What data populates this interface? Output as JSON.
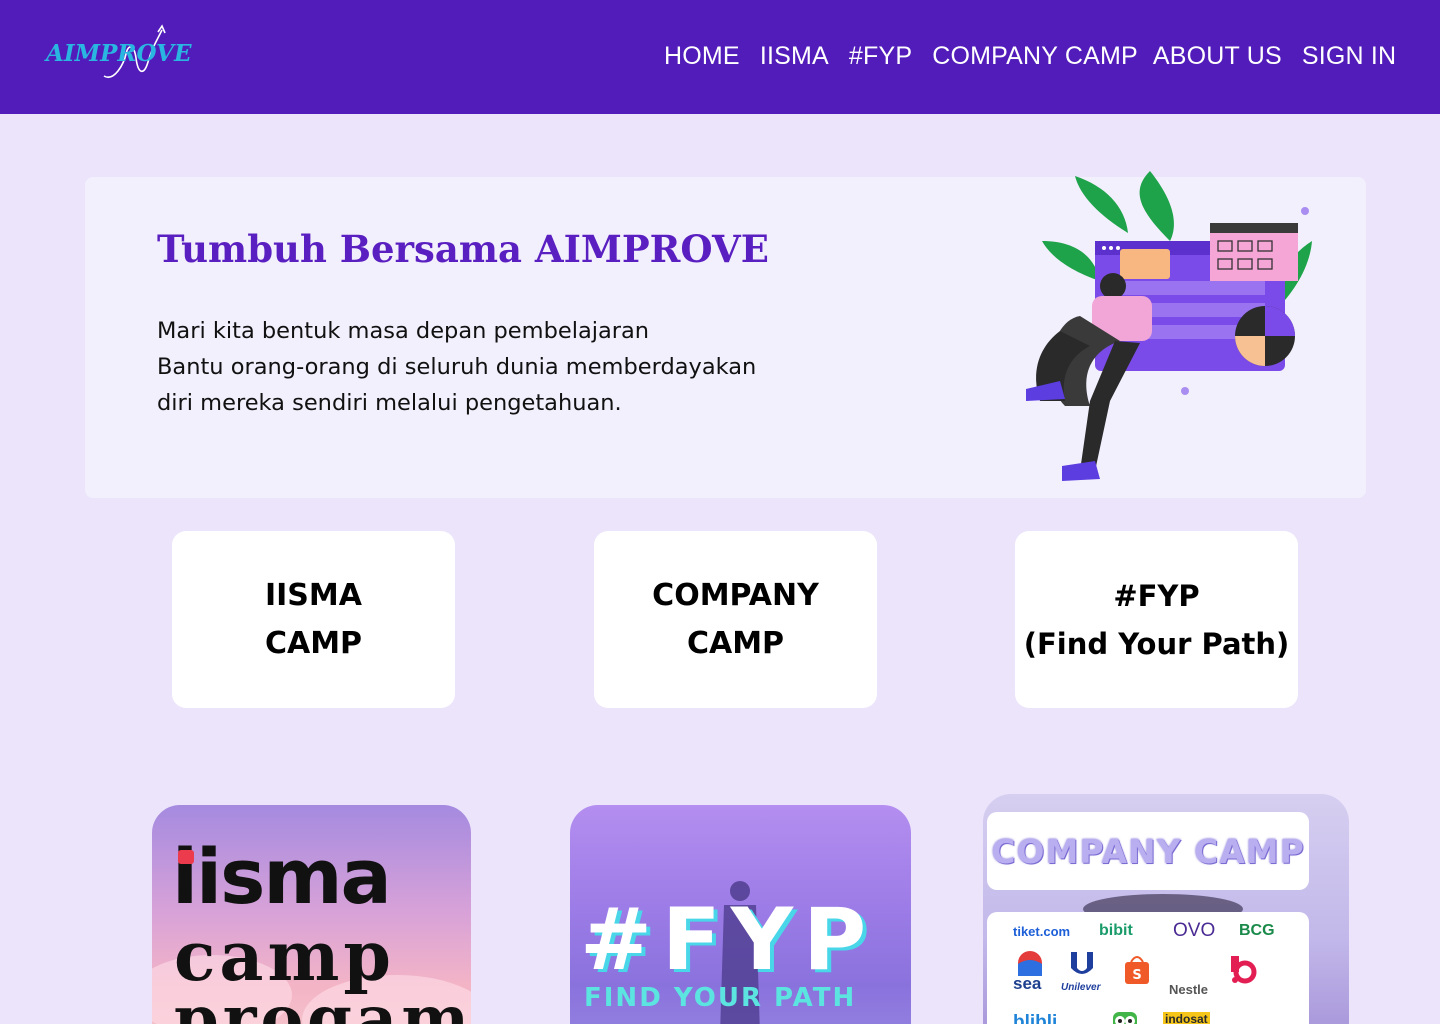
{
  "header": {
    "logo_text": "AIMPROVE",
    "nav": [
      {
        "label": "HOME"
      },
      {
        "label": "IISMA"
      },
      {
        "label": "#FYP"
      },
      {
        "label": "COMPANY CAMP"
      },
      {
        "label": "ABOUT US"
      },
      {
        "label": "SIGN IN"
      }
    ]
  },
  "hero": {
    "title": "Tumbuh Bersama AIMPROVE",
    "lines": [
      "Mari kita bentuk masa depan pembelajaran",
      "Bantu orang-orang di seluruh dunia memberdayakan",
      "diri mereka sendiri melalui pengetahuan."
    ]
  },
  "categories": [
    {
      "line1": "IISMA",
      "line2": "CAMP"
    },
    {
      "line1": "COMPANY",
      "line2": "CAMP"
    },
    {
      "line1": "#FYP",
      "line2": "(Find Your Path)"
    }
  ],
  "promos": {
    "iisma": {
      "line1": "iisma",
      "line2": "camp",
      "line3": "progam"
    },
    "fyp": {
      "title": "#FYP",
      "subtitle": "FIND YOUR PATH"
    },
    "company": {
      "title": "COMPANY CAMP",
      "partners": [
        "tiket.com",
        "bibit",
        "OVO",
        "BCG",
        "sea",
        "Unilever",
        "Nestle",
        "blibli",
        "indosat"
      ]
    }
  },
  "colors": {
    "navbar": "#521cbb",
    "page_bg": "#ebe4fb",
    "hero_bg": "#f3f0fd",
    "accent": "#5a1fc0",
    "logo": "#29b6e0"
  }
}
